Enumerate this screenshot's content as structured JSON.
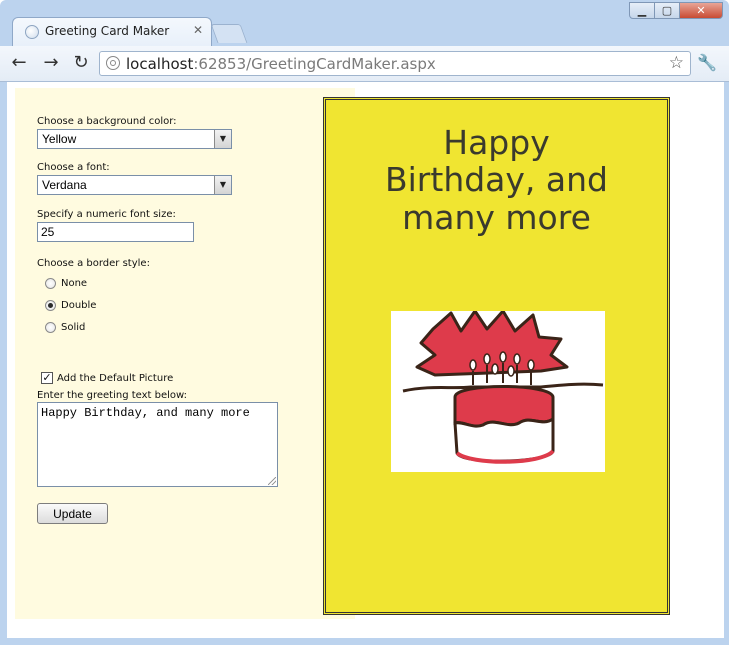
{
  "browser": {
    "tab_title": "Greeting Card Maker",
    "url_host": "localhost",
    "url_rest": ":62853/GreetingCardMaker.aspx"
  },
  "form": {
    "bg_color_label": "Choose a background color:",
    "bg_color_value": "Yellow",
    "font_label": "Choose a font:",
    "font_value": "Verdana",
    "font_size_label": "Specify a numeric font size:",
    "font_size_value": "25",
    "border_label": "Choose a border style:",
    "border_options": [
      "None",
      "Double",
      "Solid"
    ],
    "border_selected": "Double",
    "default_picture_label": "Add the Default Picture",
    "default_picture_checked": true,
    "greeting_label": "Enter the greeting text below:",
    "greeting_value": "Happy Birthday, and many more",
    "update_label": "Update"
  },
  "card": {
    "background": "#f0e531",
    "border_style": "double",
    "greeting": "Happy Birthday, and many more",
    "picture": "birthday-cake-drawing"
  },
  "colors": {
    "panel_bg": "#fffbe0",
    "card_bg": "#f0e531",
    "cake_red": "#de3b4b",
    "cake_outline": "#3a2418"
  }
}
